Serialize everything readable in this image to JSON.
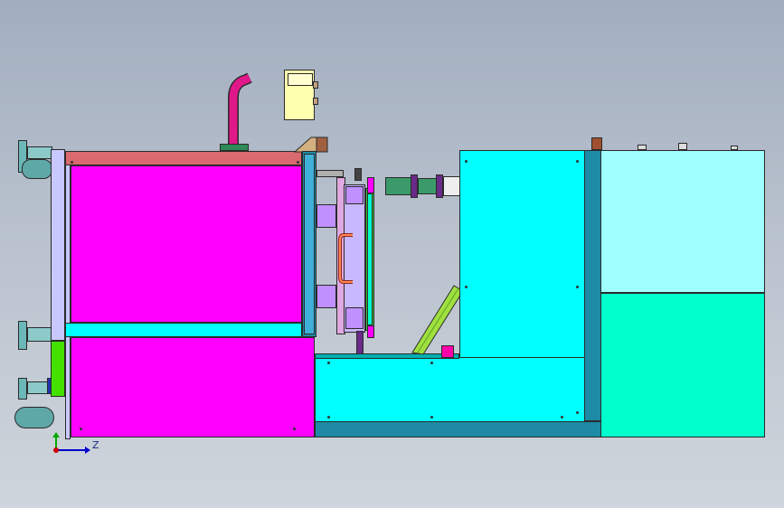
{
  "viewport": {
    "background_top": "#a2aebf",
    "background_bottom": "#cfd5dc"
  },
  "colors": {
    "magenta": "#ff00ff",
    "cyan": "#00ffff",
    "light_cyan": "#a0ffff",
    "teal_green": "#00ffcc",
    "steel_blue": "#1e8aa5",
    "frame_pink": "#d86a70",
    "lavender": "#c8c8ff",
    "violet": "#c090ff",
    "lime": "#44e000",
    "olive": "#9fb040",
    "pale_yellow": "#ffffb0",
    "blower_teal": "#5fa8a8"
  },
  "triad": {
    "z_label": "Z",
    "x_color": "#0000cc",
    "y_color": "#00aa00",
    "origin_color": "#cc0000"
  }
}
